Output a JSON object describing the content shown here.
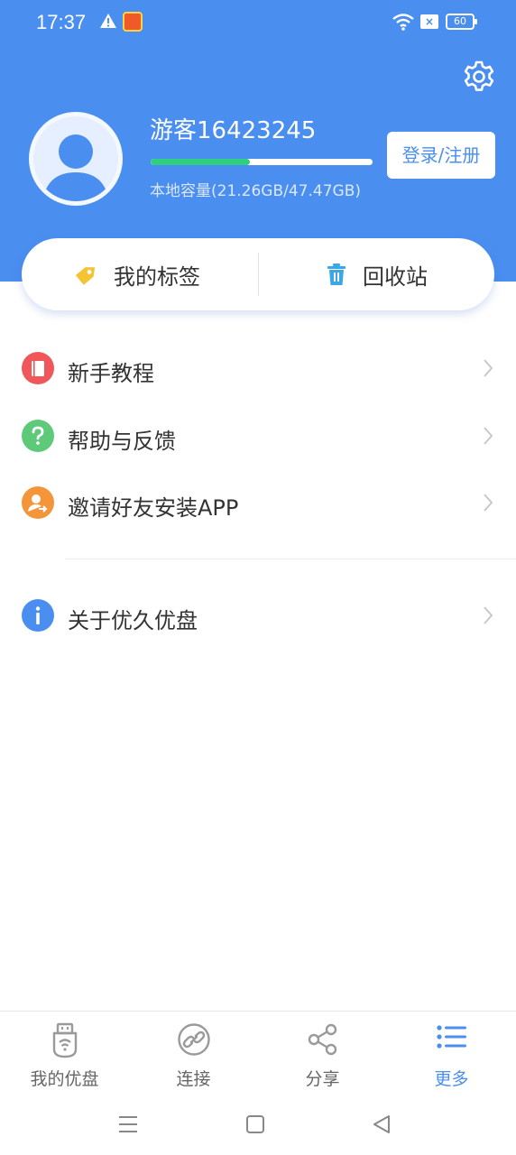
{
  "status_bar": {
    "time": "17:37",
    "battery": "60",
    "icons": [
      "warning-icon",
      "app-notification-icon",
      "wifi-icon",
      "sim-x-icon",
      "battery-icon"
    ]
  },
  "header": {
    "username": "游客16423245",
    "storage_text": "本地容量(21.26GB/47.47GB)",
    "storage_used_fraction": 0.448,
    "login_button": "登录/注册",
    "settings_icon": "gear-icon",
    "background_color": "#4a8ef0"
  },
  "quick_actions": [
    {
      "label": "我的标签",
      "icon": "tag-icon",
      "color": "#f5c435"
    },
    {
      "label": "回收站",
      "icon": "trash-icon",
      "color": "#3aa7e6"
    }
  ],
  "menu": [
    {
      "label": "新手教程",
      "icon": "book-icon",
      "color": "#f0575b"
    },
    {
      "label": "帮助与反馈",
      "icon": "question-icon",
      "color": "#5fc97a"
    },
    {
      "label": "邀请好友安装APP",
      "icon": "invite-user-icon",
      "color": "#f5953a"
    },
    {
      "label": "关于优久优盘",
      "icon": "info-icon",
      "color": "#4a8ef0"
    }
  ],
  "bottom_nav": [
    {
      "label": "我的优盘",
      "icon": "usb-drive-icon",
      "active": false
    },
    {
      "label": "连接",
      "icon": "link-icon",
      "active": false
    },
    {
      "label": "分享",
      "icon": "share-icon",
      "active": false
    },
    {
      "label": "更多",
      "icon": "list-icon",
      "active": true
    }
  ],
  "system_nav": [
    "menu-icon",
    "home-square-icon",
    "back-triangle-icon"
  ]
}
